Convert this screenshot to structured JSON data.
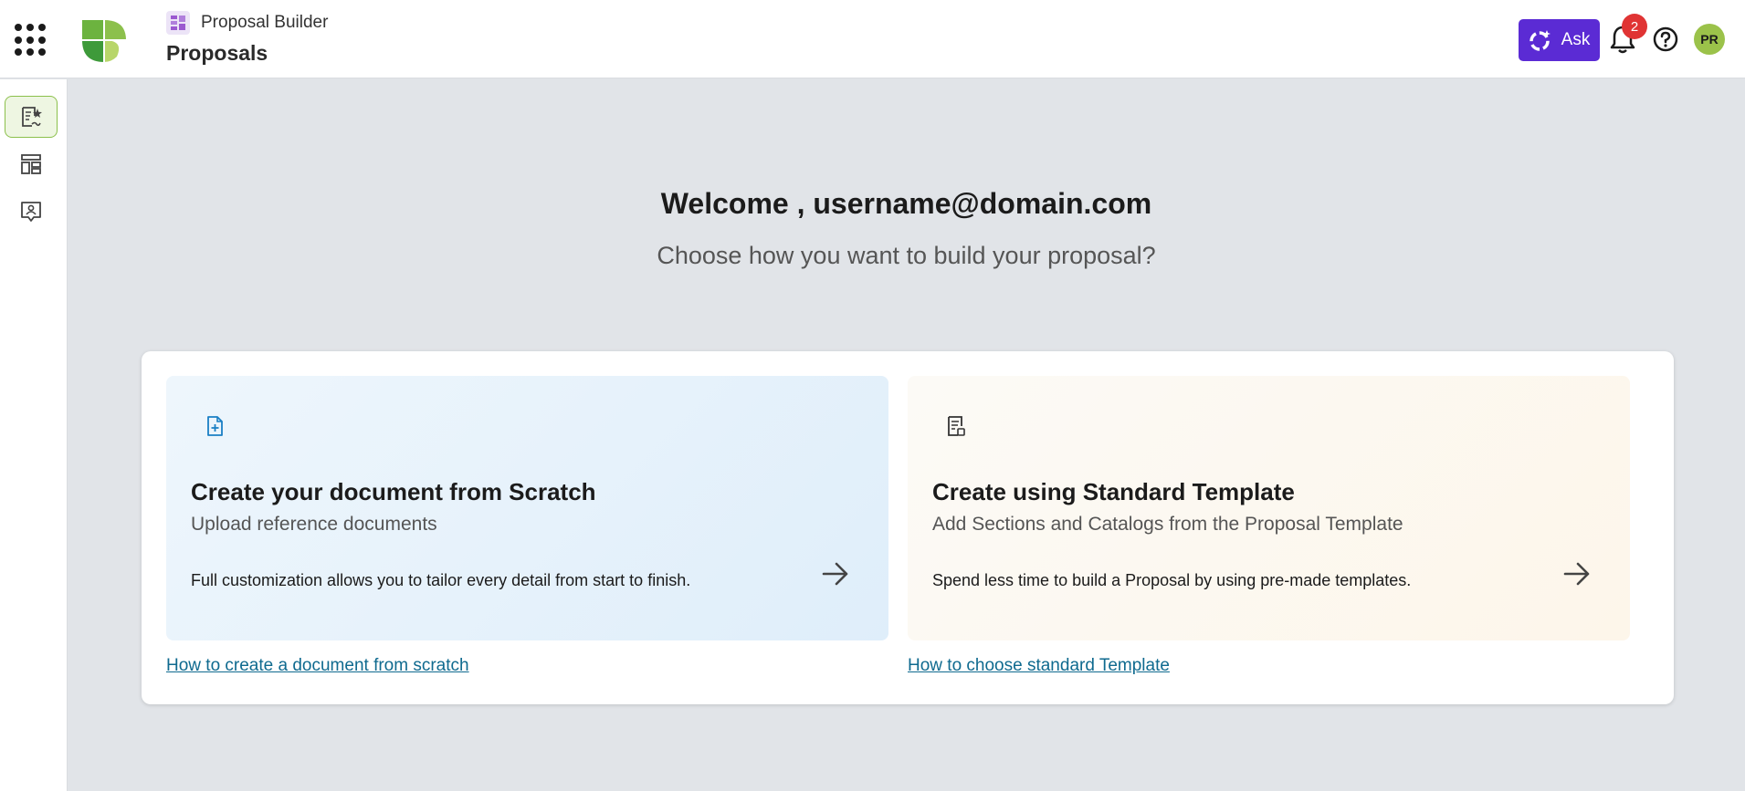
{
  "header": {
    "apps_icon": "apps-grid-icon",
    "logo_icon": "company-logo",
    "app_icon": "proposal-builder-icon",
    "app_name": "Proposal Builder",
    "page_title": "Proposals",
    "ask_label": "Ask",
    "ask_icon": "ai-sparkle-icon",
    "notification_count": "2",
    "avatar_initials": "PR",
    "colors": {
      "ask_button": "#5b2bd4",
      "badge": "#e03434",
      "avatar": "#9bc24a",
      "logo_green": "#6cb33f"
    }
  },
  "sidebar": {
    "items": [
      {
        "icon": "proposal-create-icon",
        "active": true
      },
      {
        "icon": "layout-templates-icon",
        "active": false
      },
      {
        "icon": "contact-card-icon",
        "active": false
      }
    ]
  },
  "main": {
    "welcome": "Welcome , username@domain.com",
    "subtitle": "Choose how you want to build your proposal?",
    "cards": [
      {
        "icon": "file-add-icon",
        "title": "Create your document from Scratch",
        "subtitle": "Upload reference documents",
        "description": "Full customization allows you to tailor every detail from start to finish.",
        "arrow_icon": "arrow-right-icon",
        "help_link": "How to create a document from scratch"
      },
      {
        "icon": "template-document-icon",
        "title": "Create using Standard Template",
        "subtitle": "Add Sections and Catalogs from the Proposal Template",
        "description": "Spend less time to build a Proposal by using pre-made templates.",
        "arrow_icon": "arrow-right-icon",
        "help_link": "How to choose standard Template"
      }
    ]
  }
}
